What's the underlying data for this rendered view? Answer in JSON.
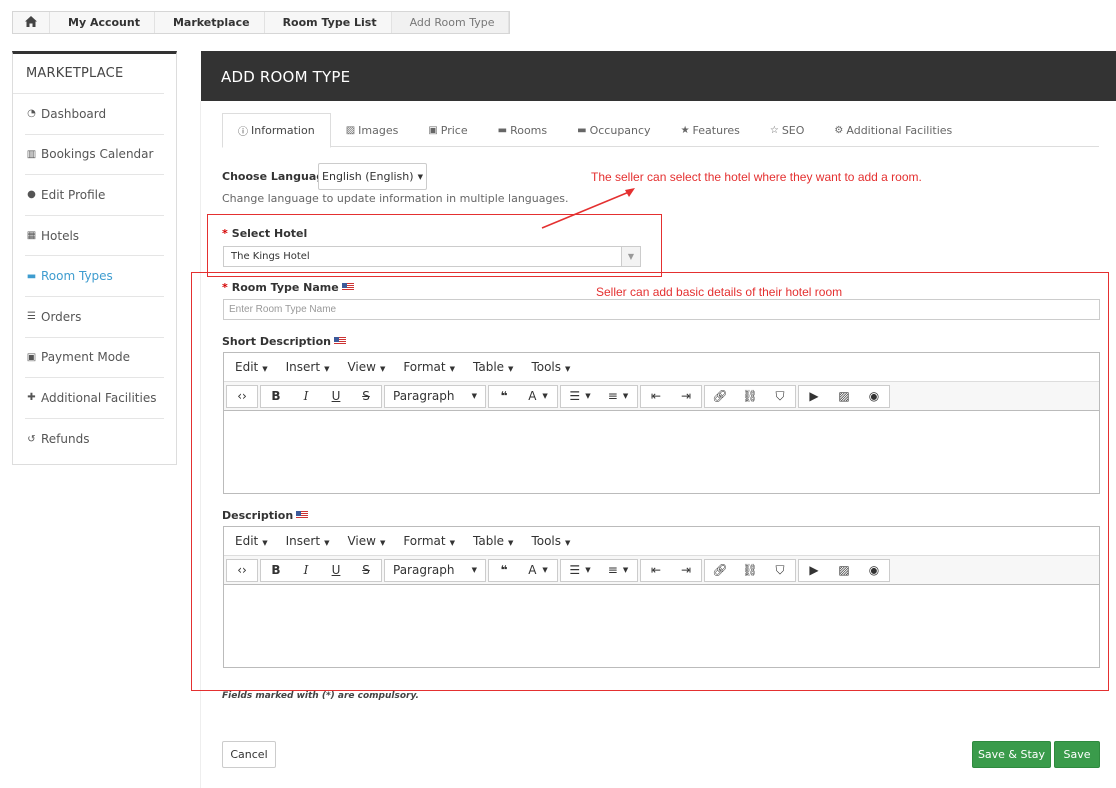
{
  "breadcrumb": {
    "home_icon": "home-icon",
    "items": [
      "My Account",
      "Marketplace",
      "Room Type List",
      "Add Room Type"
    ]
  },
  "sidebar": {
    "title": "MARKETPLACE",
    "items": [
      {
        "label": "Dashboard",
        "icon": "dashboard-icon"
      },
      {
        "label": "Bookings Calendar",
        "icon": "bar-chart-icon"
      },
      {
        "label": "Edit Profile",
        "icon": "user-icon"
      },
      {
        "label": "Hotels",
        "icon": "building-icon"
      },
      {
        "label": "Room Types",
        "icon": "bed-icon",
        "active": true
      },
      {
        "label": "Orders",
        "icon": "list-icon"
      },
      {
        "label": "Payment Mode",
        "icon": "money-icon"
      },
      {
        "label": "Additional Facilities",
        "icon": "user-plus-icon"
      },
      {
        "label": "Refunds",
        "icon": "refresh-icon"
      }
    ],
    "active_color": "#3e9ccf"
  },
  "header": {
    "title": "ADD ROOM TYPE"
  },
  "tabs": [
    {
      "label": "Information",
      "icon": "info-circle-icon",
      "active": true
    },
    {
      "label": "Images",
      "icon": "image-icon"
    },
    {
      "label": "Price",
      "icon": "money-icon"
    },
    {
      "label": "Rooms",
      "icon": "bed-icon"
    },
    {
      "label": "Occupancy",
      "icon": "bed-icon"
    },
    {
      "label": "Features",
      "icon": "star-icon"
    },
    {
      "label": "SEO",
      "icon": "star-outline-icon"
    },
    {
      "label": "Additional Facilities",
      "icon": "gear-icon"
    }
  ],
  "form": {
    "language_label": "Choose Language:",
    "language_value": "English (English)",
    "language_help": "Change language to update information in multiple languages.",
    "hotel_label": "Select Hotel",
    "hotel_value": "The Kings Hotel",
    "room_name_label": "Room Type Name",
    "room_name_placeholder": "Enter Room Type Name",
    "short_desc_label": "Short Description",
    "desc_label": "Description",
    "footnote": "Fields marked with (*) are compulsory."
  },
  "editor": {
    "menu": [
      "Edit",
      "Insert",
      "View",
      "Format",
      "Table",
      "Tools"
    ],
    "block_format": "Paragraph"
  },
  "annotations": {
    "hotel_note": "The seller can select the hotel where they want to add a room.",
    "details_note": "Seller can add basic details of their hotel room",
    "color": "#e43030"
  },
  "buttons": {
    "cancel": "Cancel",
    "save_stay": "Save & Stay",
    "save": "Save"
  }
}
